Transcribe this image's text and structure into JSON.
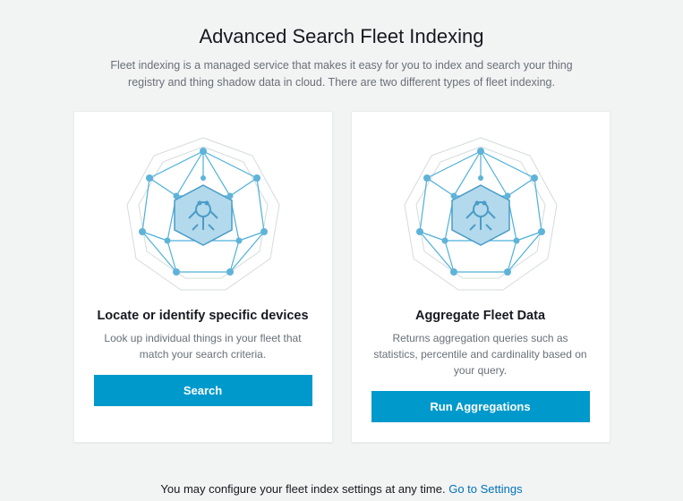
{
  "header": {
    "title": "Advanced Search Fleet Indexing",
    "subtitle": "Fleet indexing is a managed service that makes it easy for you to index and search your thing registry and thing shadow data in cloud. There are two different types of fleet indexing."
  },
  "cards": {
    "search": {
      "title": "Locate or identify specific devices",
      "desc": "Look up individual things in your fleet that match your search criteria.",
      "button": "Search"
    },
    "aggregate": {
      "title": "Aggregate Fleet Data",
      "desc": "Returns aggregation queries such as statistics, percentile and cardinality based on your query.",
      "button": "Run Aggregations"
    }
  },
  "footer": {
    "text": "You may configure your fleet index settings at any time. ",
    "link": "Go to Settings"
  }
}
